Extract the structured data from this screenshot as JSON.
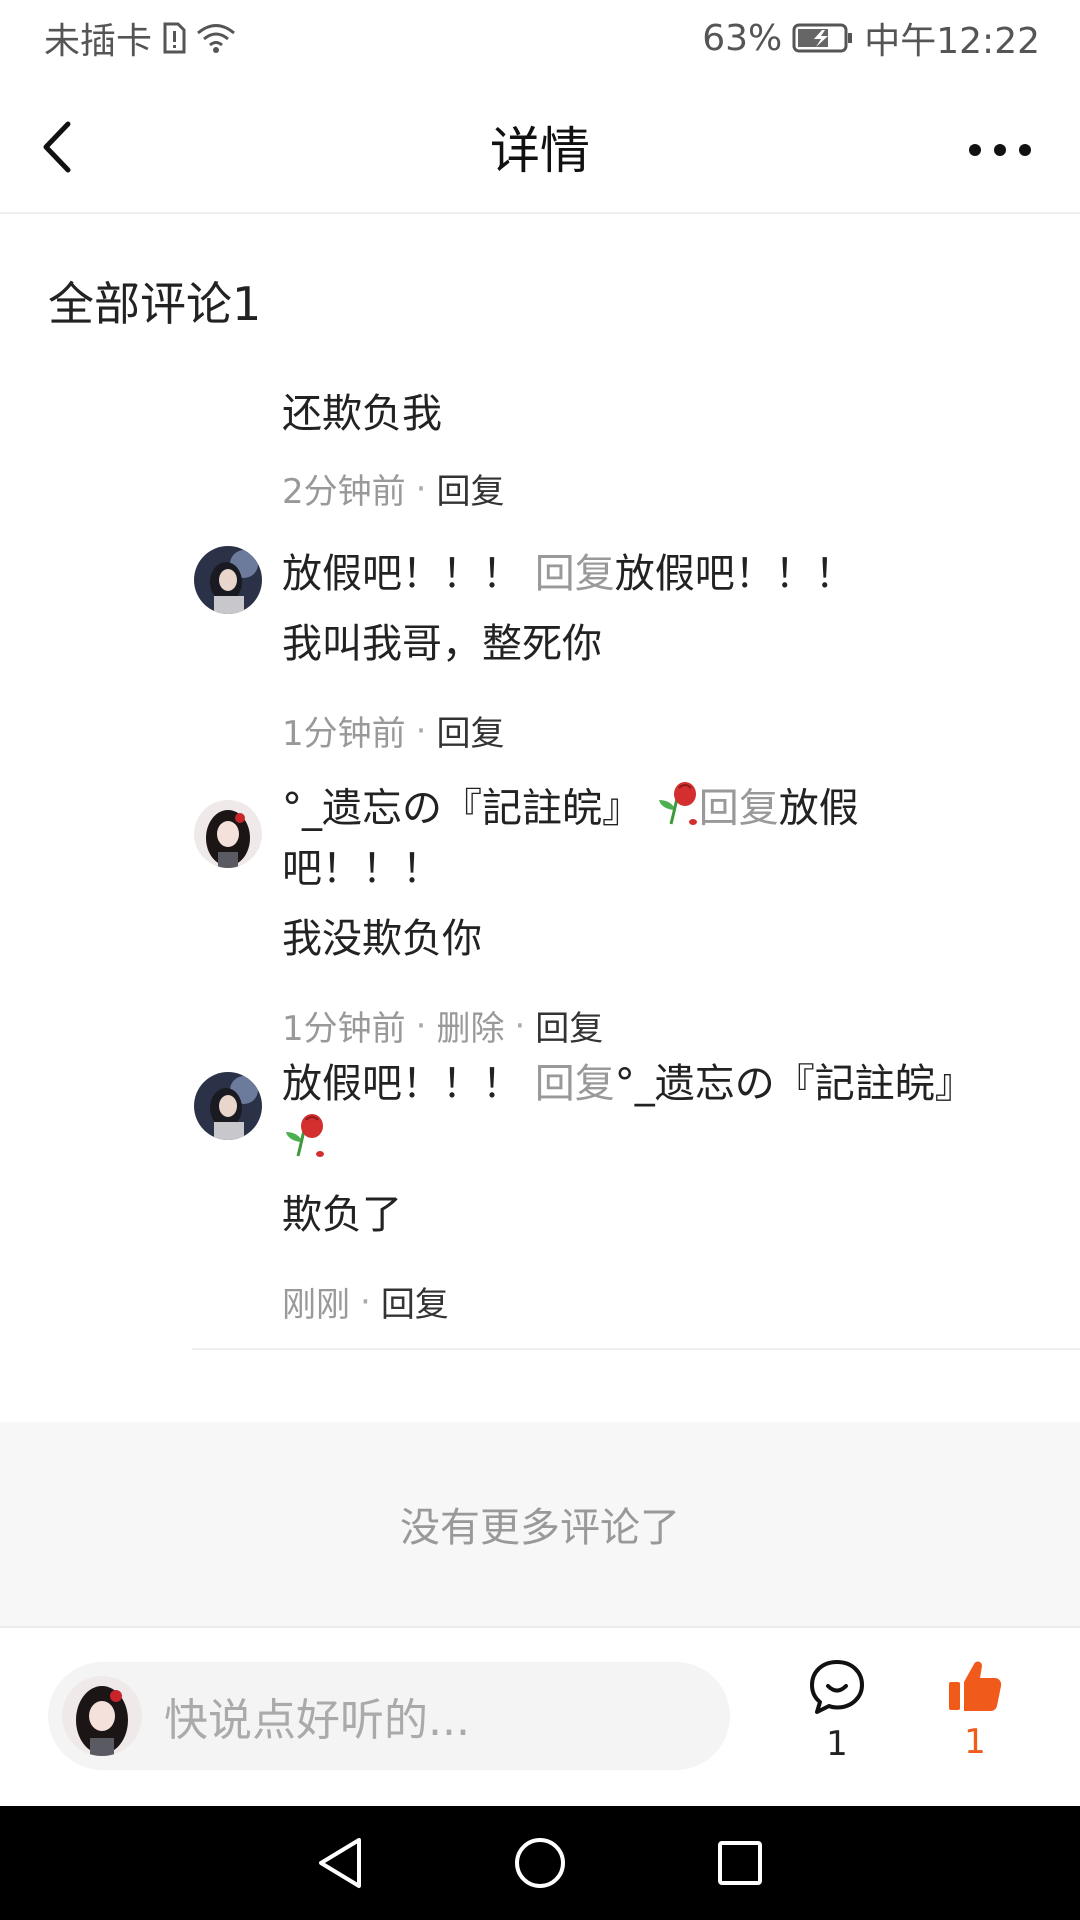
{
  "status_bar": {
    "carrier": "未插卡",
    "battery_percent": "63%",
    "time": "中午12:22"
  },
  "header": {
    "title": "详情"
  },
  "comments_section": {
    "title": "全部评论1"
  },
  "comments": [
    {
      "text": "还欺负我",
      "time": "2分钟前",
      "reply_label": "回复"
    },
    {
      "author": "放假吧！！！",
      "reply_word": "回复",
      "reply_to": "放假吧！！！",
      "text": "我叫我哥，整死你",
      "time": "1分钟前",
      "reply_label": "回复"
    },
    {
      "author": "°_遗忘の『記註皖』",
      "reply_word": "回复",
      "reply_to": "放假吧！！！",
      "text": "我没欺负你",
      "time": "1分钟前",
      "delete_label": "删除",
      "reply_label": "回复"
    },
    {
      "author": "放假吧！！！",
      "reply_word": "回复",
      "reply_to": "°_遗忘の『記註皖』",
      "text": "欺负了",
      "time": "刚刚",
      "reply_label": "回复"
    }
  ],
  "no_more_text": "没有更多评论了",
  "input_bar": {
    "placeholder": "快说点好听的...",
    "comment_count": "1",
    "like_count": "1"
  },
  "colors": {
    "accent": "#f05a1a",
    "muted": "#999999"
  }
}
